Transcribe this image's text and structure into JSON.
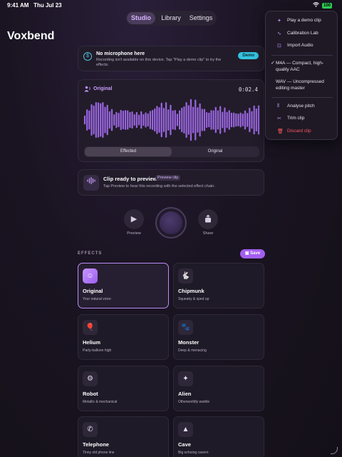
{
  "status": {
    "time": "9:41 AM",
    "date": "Thu Jul 23",
    "battery": "100"
  },
  "tabs": [
    {
      "label": "Studio"
    },
    {
      "label": "Library"
    },
    {
      "label": "Settings"
    }
  ],
  "app": {
    "title": "Voxbend"
  },
  "banner": {
    "title": "No microphone here",
    "text": "Recording isn't available on this device. Tap \"Play a demo clip\" to try the effects.",
    "button": "Demo"
  },
  "wave": {
    "title": "Original",
    "time": "0:02.4",
    "toggle": [
      "Effected",
      "Original"
    ],
    "active_toggle": "Effected"
  },
  "preview": {
    "title": "Clip ready to preview",
    "badge": "Preview clip",
    "text": "Tap Preview to hear this recording with the selected effect chain."
  },
  "controls": {
    "preview": "Preview",
    "share": "Share"
  },
  "effects": {
    "label": "EFFECTS",
    "save": "Save",
    "items": [
      {
        "name": "Original",
        "sub": "Your natural voice",
        "icon": "person-wave-icon"
      },
      {
        "name": "Chipmunk",
        "sub": "Squeaky & sped up",
        "icon": "hare-icon"
      },
      {
        "name": "Helium",
        "sub": "Party-balloon high",
        "icon": "balloon-icon"
      },
      {
        "name": "Monster",
        "sub": "Deep & menacing",
        "icon": "pawprint-icon"
      },
      {
        "name": "Robot",
        "sub": "Metallic & mechanical",
        "icon": "gears-icon"
      },
      {
        "name": "Alien",
        "sub": "Otherworldly warble",
        "icon": "sparkles-icon"
      },
      {
        "name": "Telephone",
        "sub": "Tinny old phone line",
        "icon": "phone-icon"
      },
      {
        "name": "Cave",
        "sub": "Big echoing cavern",
        "icon": "mountains-icon"
      }
    ]
  },
  "menu": {
    "items": [
      {
        "label": "Play a demo clip",
        "icon": "sparkle-icon"
      },
      {
        "label": "Calibration Lab",
        "icon": "waveform-icon"
      },
      {
        "label": "Import Audio",
        "icon": "import-icon"
      },
      {
        "label": "M4A — Compact, high-quality AAC",
        "checked": true
      },
      {
        "label": "WAV — Uncompressed editing master",
        "checked": false
      },
      {
        "label": "Analyse pitch",
        "icon": "waveform-badge-icon"
      },
      {
        "label": "Trim clip",
        "icon": "scissors-icon"
      },
      {
        "label": "Discard clip",
        "icon": "trash-icon",
        "danger": true
      }
    ]
  },
  "colors": {
    "accent": "#b98cf5",
    "demo": "#34c3df",
    "danger": "#ff5a5f"
  }
}
